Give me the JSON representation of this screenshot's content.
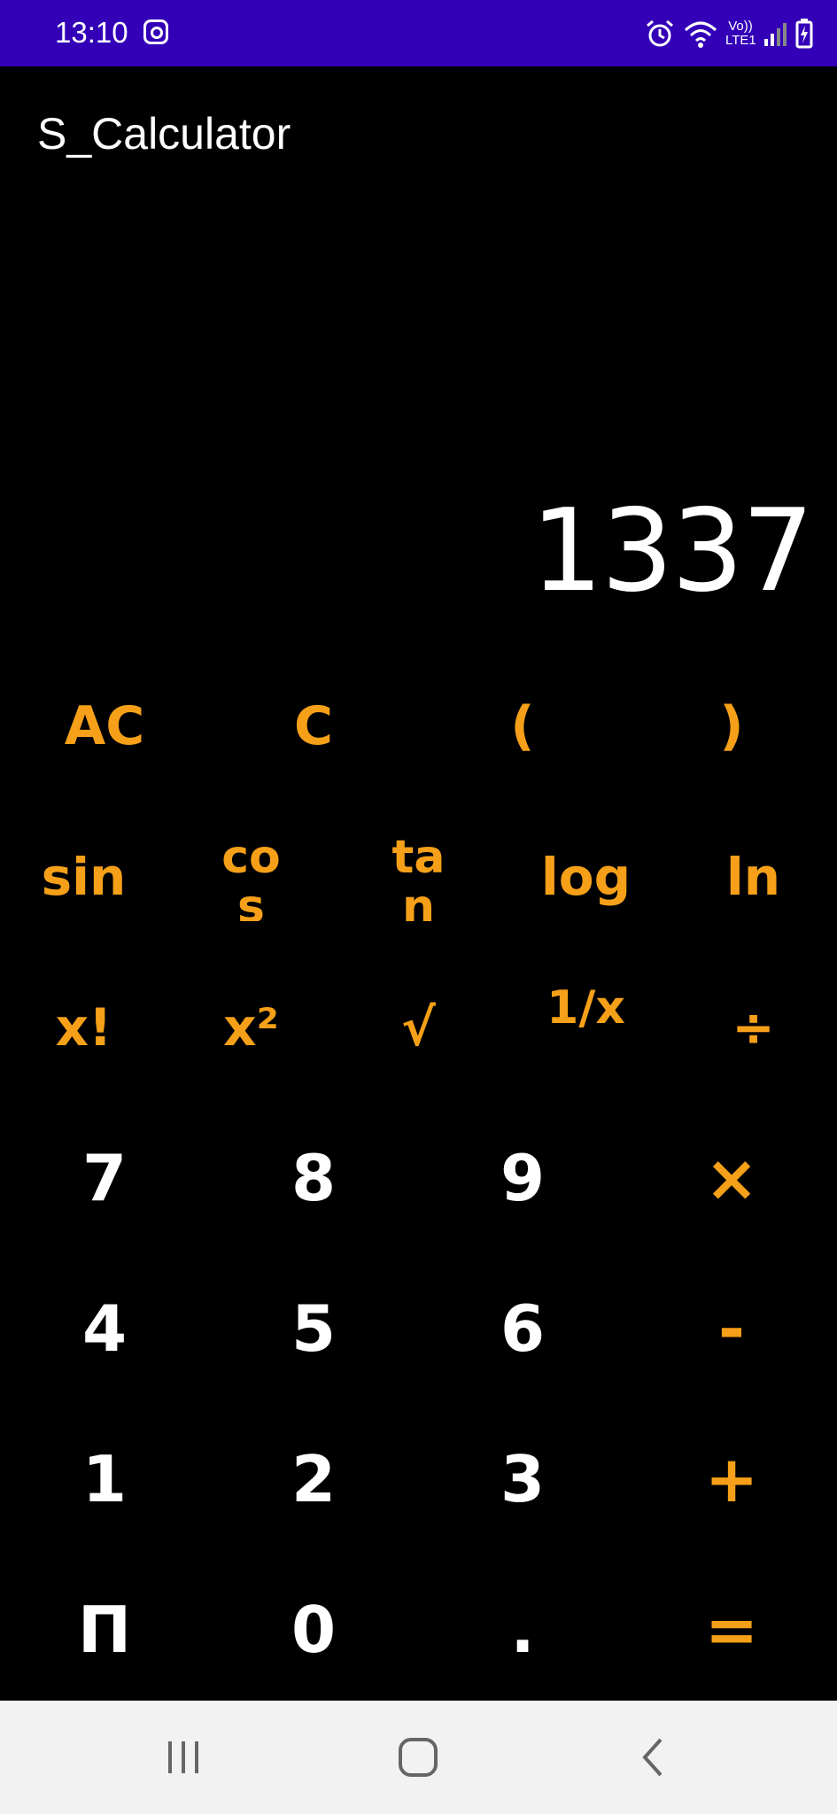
{
  "status_bar": {
    "time": "13:10",
    "network_label": "Vo)) LTE1",
    "background": "#3300b8"
  },
  "app": {
    "title": "S_Calculator",
    "display_value": "1337"
  },
  "keypad": {
    "row1": [
      "AC",
      "C",
      "(",
      ")"
    ],
    "row2": [
      "sin",
      "cos",
      "tan",
      "log",
      "ln"
    ],
    "row3": [
      "x!",
      "x²",
      "√",
      "1/x",
      "÷"
    ],
    "row4": [
      "7",
      "8",
      "9",
      "×"
    ],
    "row5": [
      "4",
      "5",
      "6",
      "-"
    ],
    "row6": [
      "1",
      "2",
      "3",
      "+"
    ],
    "row7": [
      "Π",
      "0",
      ".",
      "="
    ]
  },
  "colors": {
    "accent": "#f5a018",
    "digit": "#ffffff",
    "background": "#000000",
    "nav_bar": "#f2f2f2"
  },
  "icons": {
    "status": [
      "instagram-icon",
      "alarm-icon",
      "wifi-icon",
      "signal-icon",
      "battery-charging-icon"
    ],
    "nav": [
      "recent-apps-icon",
      "home-icon",
      "back-icon"
    ]
  }
}
